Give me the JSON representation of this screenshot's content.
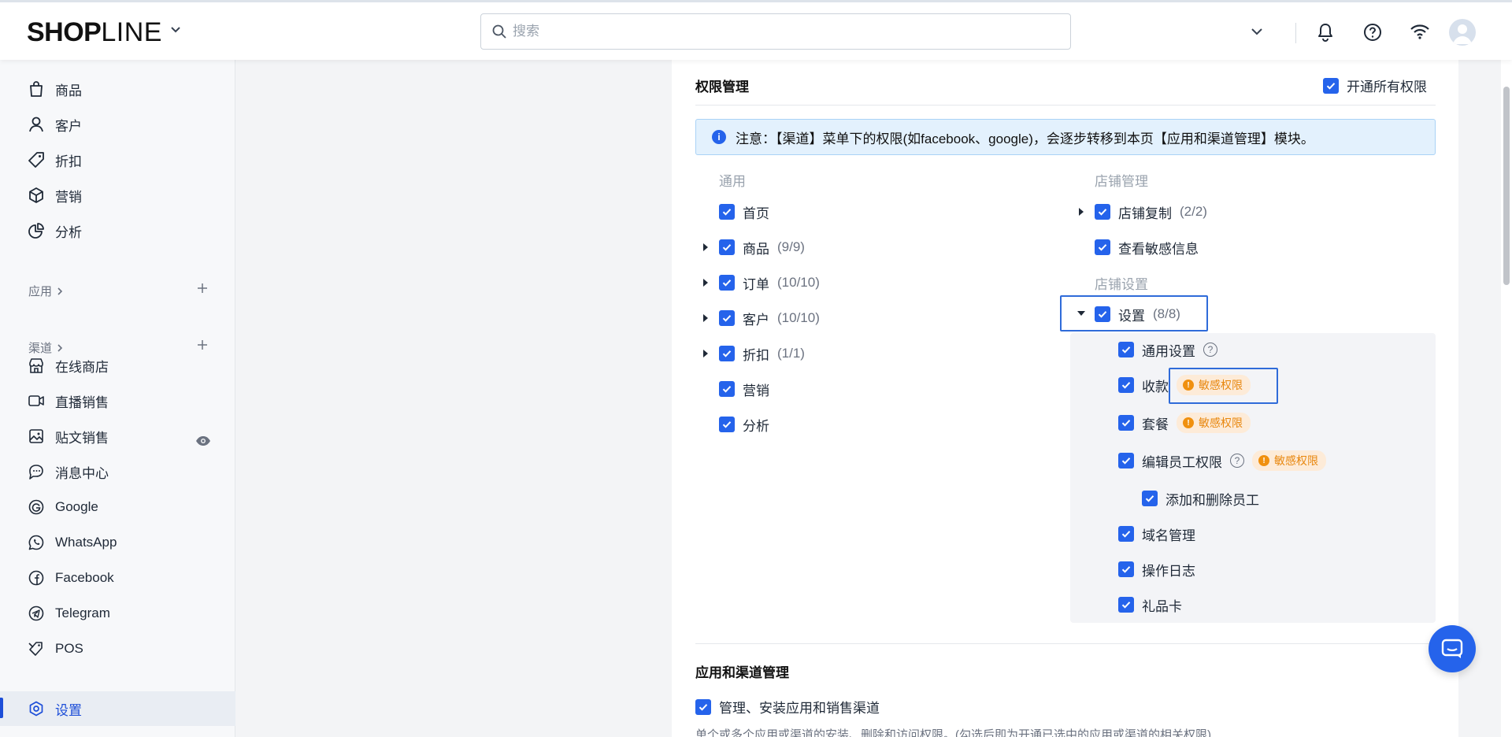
{
  "brand": {
    "logo_bold": "SHOP",
    "logo_light": "LINE"
  },
  "search": {
    "placeholder": "搜索"
  },
  "sidebar": {
    "items": [
      {
        "label": "商品",
        "icon": "bag-icon"
      },
      {
        "label": "客户",
        "icon": "person-icon"
      },
      {
        "label": "折扣",
        "icon": "tag-icon"
      },
      {
        "label": "营销",
        "icon": "cube-icon"
      },
      {
        "label": "分析",
        "icon": "pie-chart-icon"
      }
    ],
    "apps_title": "应用",
    "channels_title": "渠道",
    "channels": [
      {
        "label": "在线商店",
        "icon": "store-icon"
      },
      {
        "label": "直播销售",
        "icon": "video-icon"
      },
      {
        "label": "贴文销售",
        "icon": "image-icon"
      },
      {
        "label": "消息中心",
        "icon": "chat-icon"
      },
      {
        "label": "Google",
        "icon": "google-icon"
      },
      {
        "label": "WhatsApp",
        "icon": "whatsapp-icon"
      },
      {
        "label": "Facebook",
        "icon": "facebook-icon"
      },
      {
        "label": "Telegram",
        "icon": "telegram-icon"
      },
      {
        "label": "POS",
        "icon": "pos-tag-icon"
      }
    ],
    "settings": {
      "label": "设置",
      "icon": "gear-hex-icon",
      "active": true
    }
  },
  "permissions": {
    "title": "权限管理",
    "all_label": "开通所有权限",
    "all_checked": true,
    "notice": "注意：【渠道】菜单下的权限(如facebook、google)，会逐步转移到本页【应用和渠道管理】模块。",
    "general": {
      "title": "通用",
      "items": [
        {
          "label": "首页",
          "count": "",
          "checked": true
        },
        {
          "label": "商品",
          "count": "(9/9)",
          "checked": true,
          "expanded": false
        },
        {
          "label": "订单",
          "count": "(10/10)",
          "checked": true,
          "expanded": false
        },
        {
          "label": "客户",
          "count": "(10/10)",
          "checked": true,
          "expanded": false
        },
        {
          "label": "折扣",
          "count": "(1/1)",
          "checked": true,
          "expanded": false
        },
        {
          "label": "营销",
          "count": "",
          "checked": true
        },
        {
          "label": "分析",
          "count": "",
          "checked": true
        }
      ]
    },
    "store_mgmt": {
      "title": "店铺管理",
      "items": [
        {
          "label": "店铺复制",
          "count": "(2/2)",
          "checked": true,
          "expanded": false
        },
        {
          "label": "查看敏感信息",
          "count": "",
          "checked": true
        }
      ]
    },
    "store_settings": {
      "title": "店铺设置",
      "settings": {
        "label": "设置",
        "count": "(8/8)",
        "checked": true,
        "expanded": true
      },
      "sub_items": [
        {
          "label": "通用设置",
          "checked": true
        },
        {
          "label": "收款",
          "checked": true
        },
        {
          "label": "套餐",
          "checked": true
        },
        {
          "label": "编辑员工权限",
          "checked": true
        },
        {
          "label": "添加和删除员工",
          "checked": true
        },
        {
          "label": "域名管理",
          "checked": true
        },
        {
          "label": "操作日志",
          "checked": true
        },
        {
          "label": "礼品卡",
          "checked": true
        }
      ],
      "sensitive_badge": "敏感权限"
    }
  },
  "apps_channels": {
    "title": "应用和渠道管理",
    "option": "管理、安装应用和销售渠道",
    "option_checked": true,
    "description": "单个或多个应用或渠道的安装、删除和访问权限。(勾选后即为开通已选中的应用或渠道的相关权限)"
  },
  "colors": {
    "accent": "#2563eb",
    "sensitive": "#e8870e",
    "highlight_border": "#2f6bd9",
    "notice_bg": "#e3f1fd"
  }
}
